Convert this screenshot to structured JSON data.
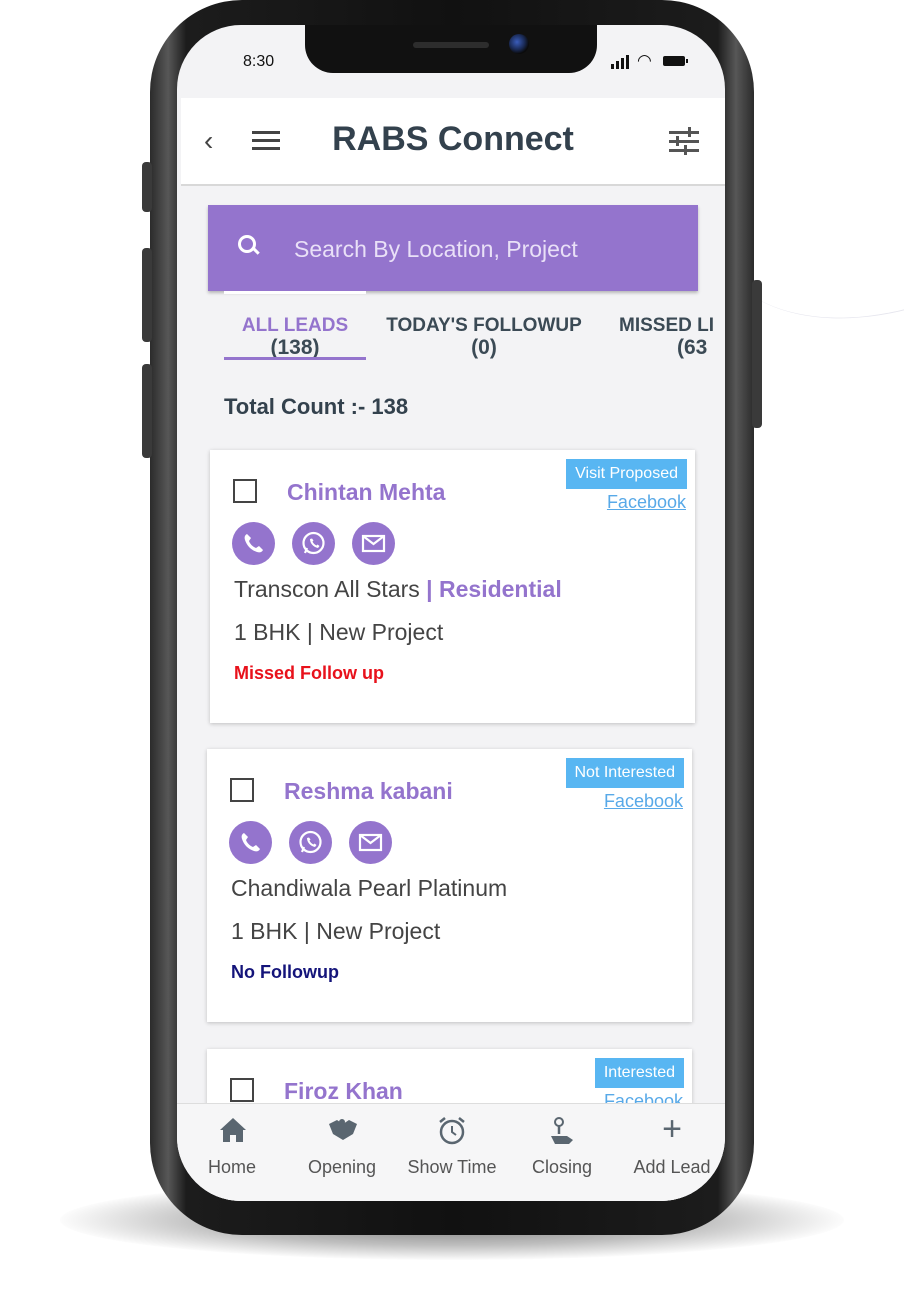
{
  "status_bar": {
    "time": "8:30"
  },
  "app": {
    "title": "RABS Connect"
  },
  "search": {
    "placeholder": "Search By Location, Project"
  },
  "tabs": [
    {
      "label": "ALL LEADS",
      "count": "(138)"
    },
    {
      "label": "TODAY'S FOLLOWUP",
      "count": "(0)"
    },
    {
      "label": "MISSED LI",
      "count": "(63"
    }
  ],
  "total_count": "Total Count :- 138",
  "leads": [
    {
      "name": "Chintan Mehta",
      "status": "Visit Proposed",
      "source": "Facebook",
      "project": "Transcon All Stars",
      "separator": " | ",
      "category": "Residential",
      "unit": "1 BHK | New Project",
      "followup": "Missed Follow up",
      "followup_color": "#e8111b"
    },
    {
      "name": "Reshma kabani",
      "status": "Not Interested",
      "source": "Facebook",
      "project": "Chandiwala Pearl Platinum",
      "separator": "",
      "category": "",
      "unit": "1 BHK | New Project",
      "followup": "No Followup",
      "followup_color": "#14147a"
    },
    {
      "name": "Firoz Khan",
      "status": "Interested",
      "source": "Facebook"
    }
  ],
  "bottom_nav": [
    {
      "label": "Home",
      "icon": "home-icon"
    },
    {
      "label": "Opening",
      "icon": "handshake-icon"
    },
    {
      "label": "Show Time",
      "icon": "alarm-clock-icon"
    },
    {
      "label": "Closing",
      "icon": "hand-key-icon"
    },
    {
      "label": "Add Lead",
      "icon": "plus-icon"
    }
  ],
  "colors": {
    "accent": "#9474cd",
    "badge": "#58b6f2",
    "title": "#33414d"
  }
}
